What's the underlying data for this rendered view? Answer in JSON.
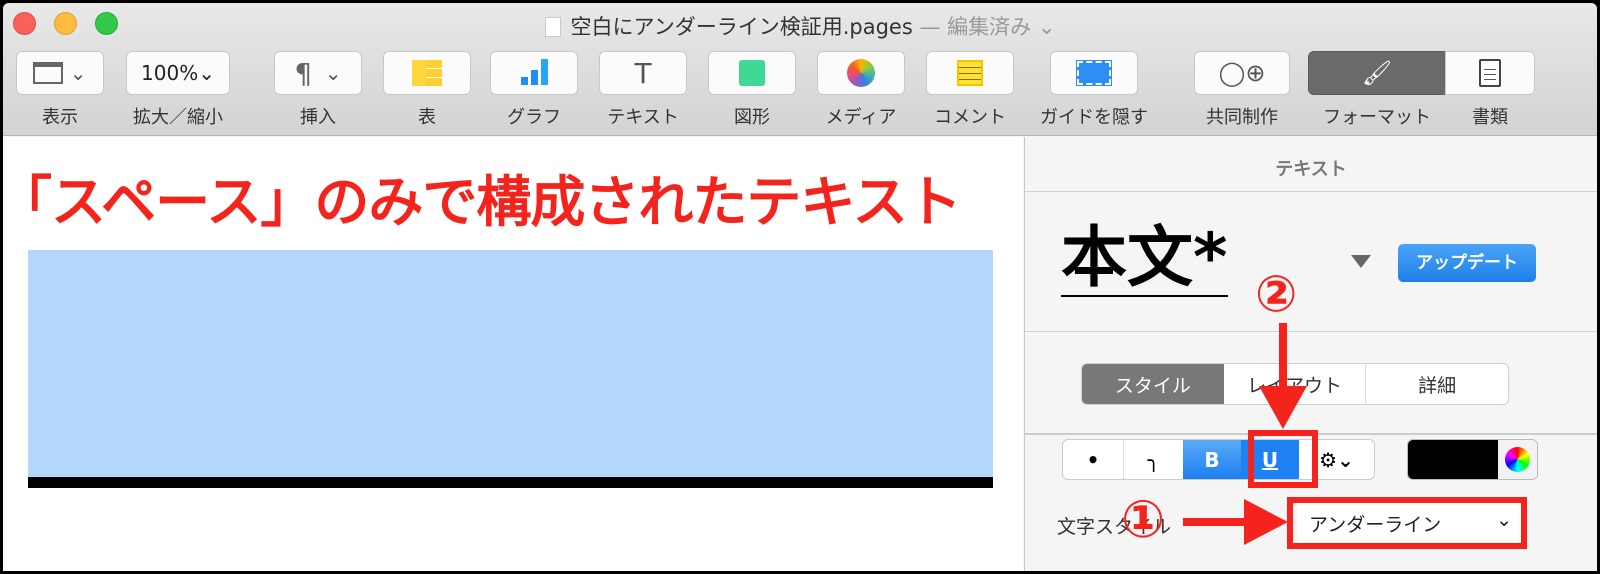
{
  "window": {
    "title": "空白にアンダーライン検証用.pages",
    "title_status": "— 編集済み"
  },
  "toolbar": [
    {
      "id": "view",
      "label": "表示",
      "icon": "sidebar-icon"
    },
    {
      "id": "zoom",
      "label": "拡大／縮小",
      "value": "100%"
    },
    {
      "id": "insert",
      "label": "挿入",
      "icon": "pilcrow-icon"
    },
    {
      "id": "table",
      "label": "表",
      "icon": "table-icon"
    },
    {
      "id": "chart",
      "label": "グラフ",
      "icon": "chart-icon"
    },
    {
      "id": "text",
      "label": "テキスト",
      "icon": "text-icon"
    },
    {
      "id": "shape",
      "label": "図形",
      "icon": "shape-icon"
    },
    {
      "id": "media",
      "label": "メディア",
      "icon": "photos-icon"
    },
    {
      "id": "comment",
      "label": "コメント",
      "icon": "comment-icon"
    },
    {
      "id": "guides",
      "label": "ガイドを隠す",
      "icon": "guides-icon"
    },
    {
      "id": "collab",
      "label": "共同制作",
      "icon": "collaborate-icon"
    },
    {
      "id": "format",
      "label": "フォーマット",
      "icon": "paintbrush-icon"
    },
    {
      "id": "document",
      "label": "書類",
      "icon": "document-icon"
    }
  ],
  "canvas": {
    "headline": "「スペース」のみで構成されたテキスト"
  },
  "sidebar": {
    "header": "テキスト",
    "paragraph_style": "本文*",
    "update_button": "アップデート",
    "tabs": [
      "スタイル",
      "レイアウト",
      "詳細"
    ],
    "font_buttons": {
      "bold": "B",
      "underline": "U"
    },
    "char_style_label": "文字スタイル",
    "char_style_value": "アンダーライン"
  },
  "annotations": {
    "step1": "①",
    "step2": "②"
  },
  "colors": {
    "accent": "#f4241d",
    "selected": "#1a82fb",
    "text_color": "#000000"
  }
}
